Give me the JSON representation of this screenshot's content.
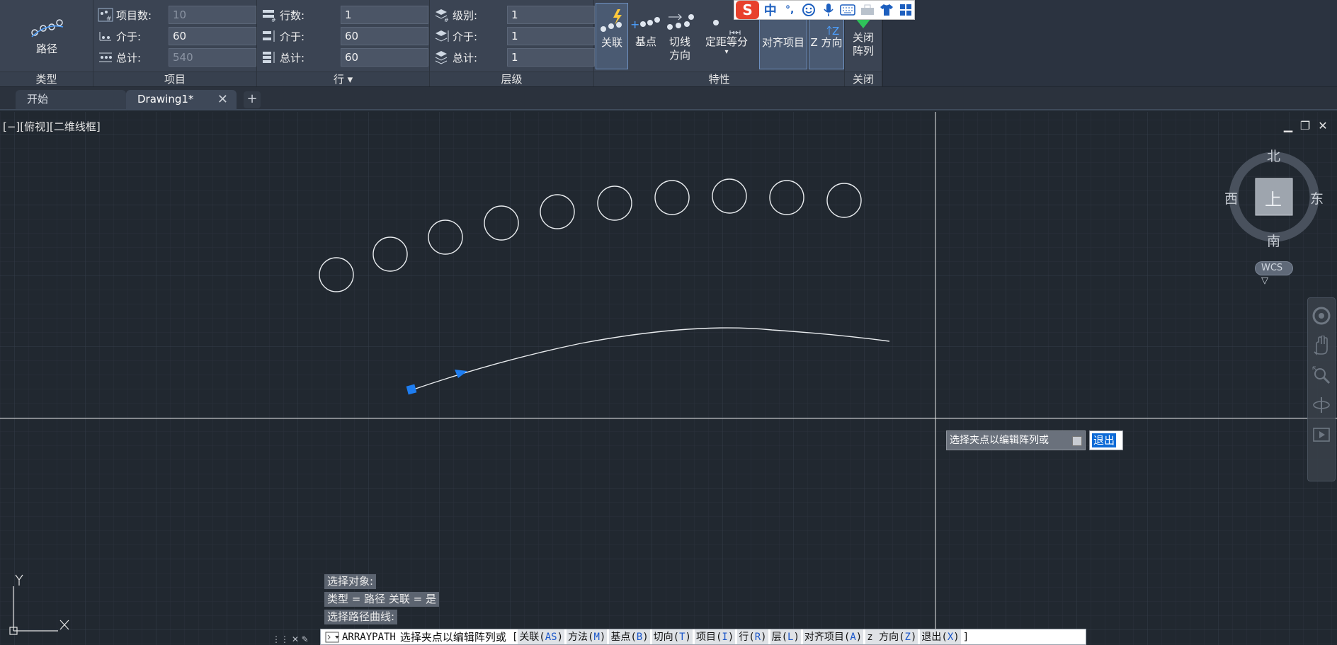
{
  "ribbon": {
    "type_panel": {
      "title": "类型",
      "path_label": "路径"
    },
    "items_panel": {
      "title": "项目",
      "rows": [
        {
          "label": "项目数:",
          "value": "10",
          "disabled": true
        },
        {
          "label": "介于:",
          "value": "60",
          "disabled": false
        },
        {
          "label": "总计:",
          "value": "540",
          "disabled": true
        }
      ]
    },
    "rows_panel": {
      "title": "行 ▾",
      "rows": [
        {
          "label": "行数:",
          "value": "1"
        },
        {
          "label": "介于:",
          "value": "60"
        },
        {
          "label": "总计:",
          "value": "60"
        }
      ]
    },
    "levels_panel": {
      "title": "层级",
      "rows": [
        {
          "label": "级别:",
          "value": "1"
        },
        {
          "label": "介于:",
          "value": "1"
        },
        {
          "label": "总计:",
          "value": "1"
        }
      ]
    },
    "properties_panel": {
      "title": "特性",
      "buttons": {
        "associative": "关联",
        "base_point": "基点",
        "tangent_l1": "切线",
        "tangent_l2": "方向",
        "measure": "定距等分",
        "align_items": "对齐项目",
        "z_direction": "Z 方向"
      }
    },
    "close_panel": {
      "title": "关闭",
      "close_l1": "关闭",
      "close_l2": "阵列"
    }
  },
  "ime": {
    "lang": "中",
    "punct": "°,"
  },
  "tabs": [
    {
      "label": "开始"
    },
    {
      "label": "Drawing1*"
    }
  ],
  "tab_plus": "+",
  "tab_close": "✕",
  "viewport": {
    "label": "[−][俯视][二维线框]",
    "min": "▁",
    "restore": "❐",
    "close": "✕"
  },
  "viewcube": {
    "north": "北",
    "south": "南",
    "east": "东",
    "west": "西",
    "top": "上",
    "wcs": "WCS ▽"
  },
  "ucs": {
    "x": "X",
    "y": "Y"
  },
  "dynamic_input": {
    "prompt": "选择夹点以编辑阵列或",
    "exit": "退出"
  },
  "history": [
    "选择对象:",
    "类型 = 路径  关联 = 是",
    "选择路径曲线:"
  ],
  "command_line": {
    "command": "ARRAYPATH",
    "prompt": "选择夹点以编辑阵列或",
    "open_bracket": "[",
    "close_bracket": "]",
    "options": [
      {
        "label": "关联(",
        "key": "AS",
        "end": ")"
      },
      {
        "label": "方法(",
        "key": "M",
        "end": ")"
      },
      {
        "label": "基点(",
        "key": "B",
        "end": ")"
      },
      {
        "label": "切向(",
        "key": "T",
        "end": ")"
      },
      {
        "label": "项目(",
        "key": "I",
        "end": ")"
      },
      {
        "label": "行(",
        "key": "R",
        "end": ")"
      },
      {
        "label": "层(",
        "key": "L",
        "end": ")"
      },
      {
        "label": "对齐项目(",
        "key": "A",
        "end": ")"
      },
      {
        "label": "z 方向(",
        "key": "Z",
        "end": ")"
      },
      {
        "label": "退出(",
        "key": "X",
        "end": ")"
      }
    ]
  },
  "colors": {
    "background": "#212830",
    "ribbon": "#3b4453",
    "grip_blue": "#1e7df0",
    "highlight": "#0d6ad6"
  }
}
